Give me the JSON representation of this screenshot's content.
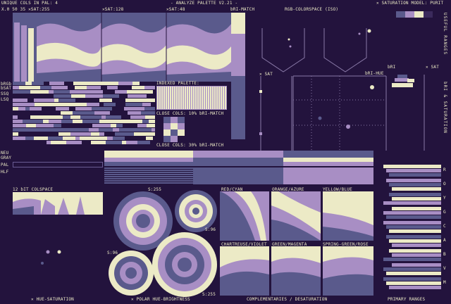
{
  "header": {
    "unique_cols": "UNIQUE COLS IN PAL: 4",
    "title": "- ANALYZE PALETTE V2.21 -",
    "saturation_model": "✕ SATURATION MODEL: PURIT",
    "sat_scale_row": "X.0 50 35 ✕SAT:255",
    "sat_128": "✕SAT:128",
    "sat_48": "✕SAT:48",
    "bri_match_top": "bRI-MATCH",
    "rgb_colorspace": "RGB-COLORSPACE (ISO)"
  },
  "left_labels": {
    "brgb": "bRGb",
    "bsat": "bSAT",
    "ssq": "SSQ",
    "lsq": "LSQ",
    "neu_gray": "NEU GRAY",
    "pal": "PAL",
    "hlf": "HLF"
  },
  "indexed": {
    "title": "INDEXED PALETTE:",
    "close_10": "CLOSE COLS: 10% bRI-MATCH",
    "close_30": "CLOSE COLS: 30% bRI-MATCH"
  },
  "rgb_panel": {
    "sat": "✕ SAT",
    "bri_hue": "bRI-HUE",
    "bri": "bRI",
    "sat2": "✕ SAT"
  },
  "right_vertical": {
    "useful_ranges": "USEFUL RANGES",
    "bri_saturation": "bRI & SATURATION",
    "hue_letters": [
      "R",
      "O",
      "Y",
      "G",
      "C",
      "A",
      "B",
      "V",
      "M"
    ]
  },
  "bottom_panels": {
    "colspace": "12 bIT COLSPACE",
    "s255_a": "S:255",
    "s96_a": "S:96",
    "s96_b": "S:96",
    "s255_b": "S:255",
    "red_cyan": "RED/CYAN",
    "orange_azure": "ORANGE/AZURE",
    "yellow_blue": "YELLOW/BLUE",
    "chartreuse_violet": "CHARTREUSE/VIOLET",
    "green_magenta": "GREEN/MAGENTA",
    "spring_rose": "SPRING-GREEN/ROSE"
  },
  "footer": {
    "hue_sat": "✕ HUE-SATURATION",
    "polar": "✕ POLAR HUE-BRIGHTNESS",
    "complementaries": "COMPLEMENTARIES / DESATURATION",
    "primary_ranges": "PRIMARY RANGES"
  },
  "palette": {
    "dark": "#23133d",
    "slate": "#5a5a8c",
    "lilac": "#a88ec4",
    "cream": "#eceac6"
  }
}
